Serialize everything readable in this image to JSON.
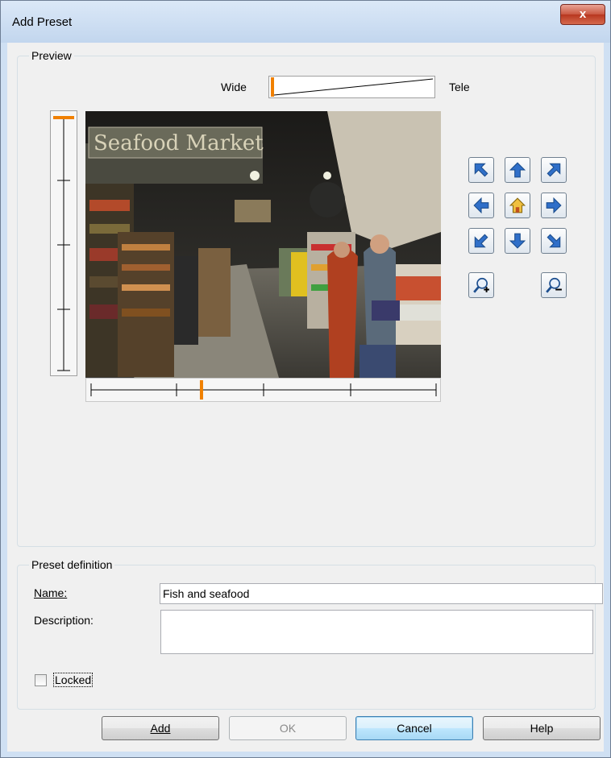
{
  "window": {
    "title": "Add Preset",
    "close_glyph": "x"
  },
  "preview": {
    "group_label": "Preview",
    "zoom": {
      "wide_label": "Wide",
      "tele_label": "Tele",
      "level": 0.0
    },
    "tilt_position": 0.0,
    "pan_position": 0.32,
    "camera_scene_sign": "Seafood Market",
    "ptz_buttons": [
      {
        "name": "move-up-left-button",
        "icon": "arrow-up-left-icon"
      },
      {
        "name": "move-up-button",
        "icon": "arrow-up-icon"
      },
      {
        "name": "move-up-right-button",
        "icon": "arrow-up-right-icon"
      },
      {
        "name": "move-left-button",
        "icon": "arrow-left-icon"
      },
      {
        "name": "home-button",
        "icon": "home-icon"
      },
      {
        "name": "move-right-button",
        "icon": "arrow-right-icon"
      },
      {
        "name": "move-down-left-button",
        "icon": "arrow-down-left-icon"
      },
      {
        "name": "move-down-button",
        "icon": "arrow-down-icon"
      },
      {
        "name": "move-down-right-button",
        "icon": "arrow-down-right-icon"
      },
      {
        "name": "zoom-in-button",
        "icon": "zoom-in-icon"
      },
      {
        "name": "zoom-out-button",
        "icon": "zoom-out-icon"
      }
    ]
  },
  "definition": {
    "group_label": "Preset definition",
    "name_label": "Name:",
    "name_value": "Fish and seafood",
    "description_label": "Description:",
    "description_value": "",
    "locked_label": "Locked",
    "locked_checked": false
  },
  "buttons": {
    "add": "Add",
    "ok": "OK",
    "cancel": "Cancel",
    "help": "Help"
  },
  "colors": {
    "accent": "#f08000",
    "arrow_blue": "#2f6fc9",
    "title_bar": "#c9dcf1"
  }
}
